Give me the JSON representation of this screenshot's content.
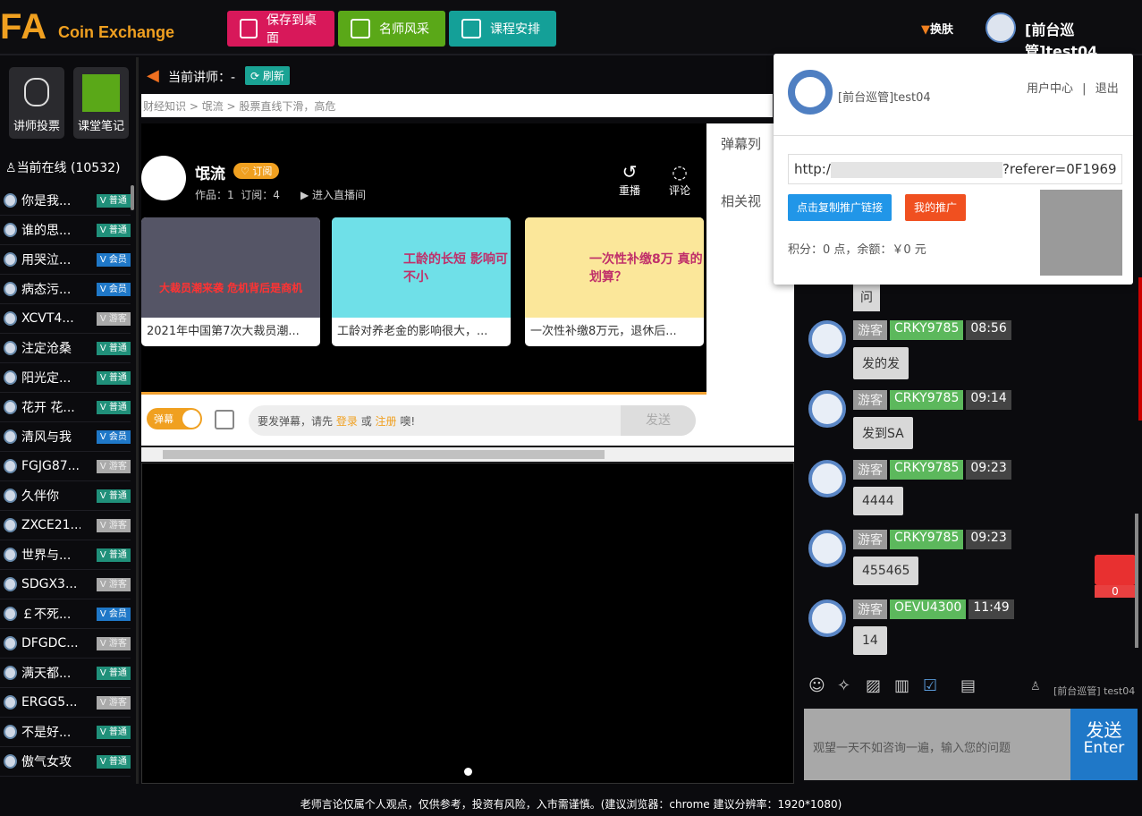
{
  "header": {
    "logo_fa": "FA",
    "logo_text": "Coin Exchange",
    "buttons": [
      {
        "label": "保存到桌面",
        "color": "#d8185a"
      },
      {
        "label": "名师风采",
        "color": "#5aa818"
      },
      {
        "label": "课程安排",
        "color": "#14a098"
      }
    ],
    "skin": "换肤",
    "user": "[前台巡管]test04"
  },
  "sidebar": {
    "vote": "讲师投票",
    "notes": "课堂笔记",
    "online": "当前在线 (10532)",
    "users": [
      {
        "name": "你是我...",
        "role": "普通"
      },
      {
        "name": "谁的思...",
        "role": "普通"
      },
      {
        "name": "用哭泣...",
        "role": "会员"
      },
      {
        "name": "病态污...",
        "role": "会员"
      },
      {
        "name": "XCVT4...",
        "role": "游客"
      },
      {
        "name": "注定沧桑",
        "role": "普通"
      },
      {
        "name": "阳光定...",
        "role": "普通"
      },
      {
        "name": "花开 花...",
        "role": "普通"
      },
      {
        "name": "清风与我",
        "role": "会员"
      },
      {
        "name": "FGJG87...",
        "role": "游客"
      },
      {
        "name": "久伴你",
        "role": "普通"
      },
      {
        "name": "ZXCE21...",
        "role": "游客"
      },
      {
        "name": "世界与...",
        "role": "普通"
      },
      {
        "name": "SDGX3...",
        "role": "游客"
      },
      {
        "name": "￡不死...",
        "role": "会员"
      },
      {
        "name": "DFGDC...",
        "role": "游客"
      },
      {
        "name": "满天都...",
        "role": "普通"
      },
      {
        "name": "ERGG5...",
        "role": "游客"
      },
      {
        "name": "不是好...",
        "role": "普通"
      },
      {
        "name": "傲气女攻",
        "role": "普通"
      }
    ]
  },
  "center": {
    "teacher_label": "当前讲师：-",
    "refresh": "刷新",
    "breadcrumb": "财经知识 > 氓流 > 股票直线下滑，高危",
    "channel": {
      "name": "氓流",
      "subscribe": "订阅",
      "works": "作品：1",
      "subs": "订阅：4",
      "live": "进入直播间",
      "replay": "重播",
      "comment": "评论"
    },
    "cards": [
      {
        "title": "2021年中国第7次大裁员潮...",
        "overlay": "大裁员潮来袭 危机背后是商机"
      },
      {
        "title": "工龄对养老金的影响很大，...",
        "overlay": "工龄的长短 影响可不小"
      },
      {
        "title": "一次性补缴8万元，退休后...",
        "overlay": "一次性补缴8万 真的划算？"
      }
    ],
    "side": {
      "danmu_list": "弹幕列",
      "related": "相关视"
    },
    "danmu": {
      "toggle": "弹幕",
      "prompt": "要发弹幕，请先",
      "login": "登录",
      "or": "或",
      "register": "注册",
      "end": "噢!",
      "send": "发送"
    }
  },
  "chat": {
    "first_bubble": "问",
    "messages": [
      {
        "role": "游客",
        "user": "CRKY9785",
        "time": "08:56",
        "text": "发的发"
      },
      {
        "role": "游客",
        "user": "CRKY9785",
        "time": "09:14",
        "text": "发到SA"
      },
      {
        "role": "游客",
        "user": "CRKY9785",
        "time": "09:23",
        "text": "4444"
      },
      {
        "role": "游客",
        "user": "CRKY9785",
        "time": "09:23",
        "text": "455465"
      },
      {
        "role": "游客",
        "user": "OEVU4300",
        "time": "11:49",
        "text": "14"
      }
    ],
    "self": "[前台巡管] test04",
    "placeholder": "观望一天不如咨询一遍，输入您的问题",
    "send": "发送",
    "send_sub": "Enter",
    "redpacket": "0"
  },
  "popup": {
    "user": "[前台巡管]test04",
    "center": "用户中心",
    "sep": "|",
    "logout": "退出",
    "link_start": "http:/",
    "link_end": "?referer=0F1969",
    "copy": "点击复制推广链接",
    "mine": "我的推广",
    "points": "积分：0 点，余额：￥0 元"
  },
  "footer": "老师言论仅属个人观点，仅供参考，投资有风险，入市需谨慎。(建议浏览器：chrome 建议分辨率：1920*1080)"
}
